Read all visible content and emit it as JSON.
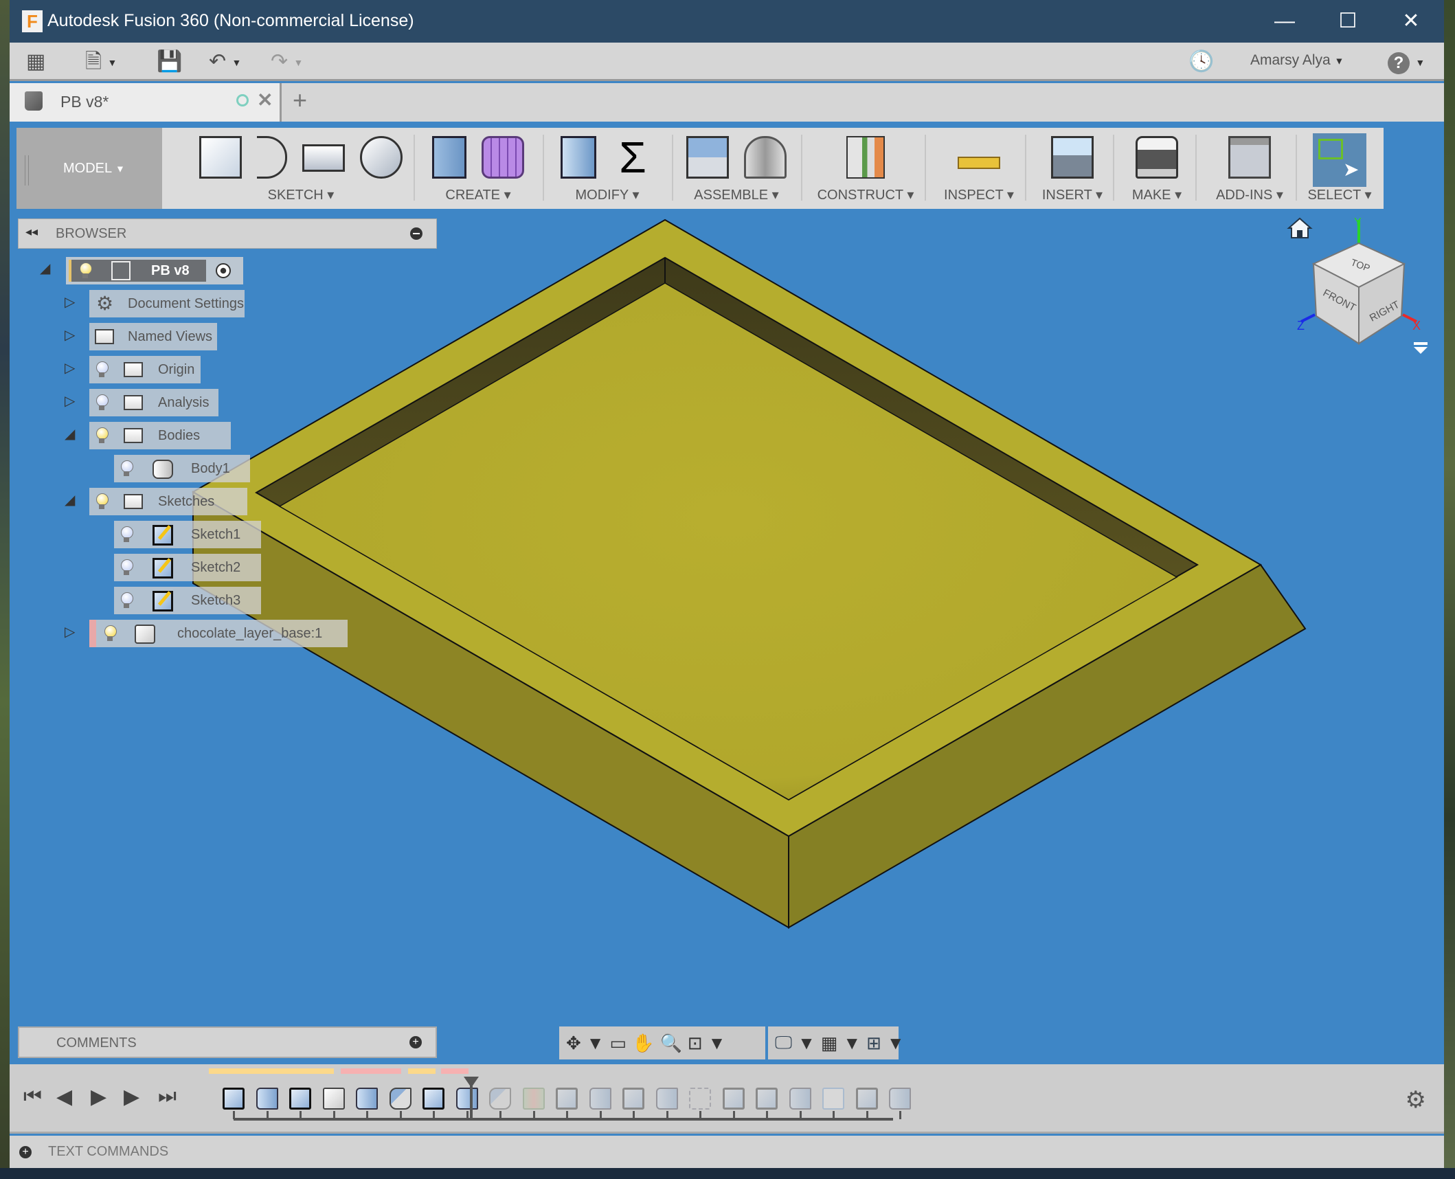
{
  "window": {
    "title": "Autodesk Fusion 360 (Non-commercial License)",
    "logo_letter": "F",
    "controls": {
      "minimize": "—",
      "maximize": "☐",
      "close": "✕"
    }
  },
  "quick_access": {
    "apps_icon": "▦",
    "file_icon": "🗎",
    "save_icon": "💾",
    "undo_icon": "↶",
    "redo_icon": "↷",
    "job_status_icon": "🕓",
    "user_name": "Amarsy Alya",
    "help_icon": "?"
  },
  "document_tab": {
    "name": "PB v8*",
    "close": "✕",
    "new_tab": "+"
  },
  "toolbar": {
    "workspace": "MODEL",
    "groups": [
      {
        "label": "SKETCH",
        "icons": [
          "create-sketch",
          "line-arc",
          "rectangle",
          "circle"
        ]
      },
      {
        "label": "CREATE",
        "icons": [
          "extrude",
          "form"
        ]
      },
      {
        "label": "MODIFY",
        "icons": [
          "press-pull",
          "parameters"
        ]
      },
      {
        "label": "ASSEMBLE",
        "icons": [
          "new-component",
          "joint"
        ]
      },
      {
        "label": "CONSTRUCT",
        "icons": [
          "offset-plane"
        ]
      },
      {
        "label": "INSPECT",
        "icons": [
          "measure"
        ]
      },
      {
        "label": "INSERT",
        "icons": [
          "insert-image"
        ]
      },
      {
        "label": "MAKE",
        "icons": [
          "3d-print"
        ]
      },
      {
        "label": "ADD-INS",
        "icons": [
          "scripts-addins"
        ]
      },
      {
        "label": "SELECT",
        "icons": [
          "window-select"
        ]
      }
    ]
  },
  "browser": {
    "title": "BROWSER",
    "root": {
      "name": "PB v8"
    },
    "nodes": [
      {
        "label": "Document Settings",
        "expanded": false
      },
      {
        "label": "Named Views",
        "expanded": false
      },
      {
        "label": "Origin",
        "expanded": false,
        "visible": false
      },
      {
        "label": "Analysis",
        "expanded": false,
        "visible": false
      },
      {
        "label": "Bodies",
        "expanded": true,
        "visible": true,
        "children": [
          {
            "label": "Body1"
          }
        ]
      },
      {
        "label": "Sketches",
        "expanded": true,
        "visible": true,
        "children": [
          {
            "label": "Sketch1"
          },
          {
            "label": "Sketch2"
          },
          {
            "label": "Sketch3"
          }
        ]
      },
      {
        "label": "chocolate_layer_base:1",
        "expanded": false,
        "visible": true
      }
    ]
  },
  "viewcube": {
    "top": "TOP",
    "front": "FRONT",
    "right": "RIGHT",
    "axis_x": "X",
    "axis_y": "Y",
    "axis_z": "Z"
  },
  "comments": {
    "title": "COMMENTS"
  },
  "navbar": {
    "icons": [
      "orbit",
      "look-at",
      "pan",
      "zoom",
      "fit",
      "display-settings",
      "grid-snaps",
      "viewports"
    ]
  },
  "timeline": {
    "active_features": [
      "sketch",
      "extrude",
      "sketch",
      "body",
      "extrude",
      "fillet",
      "sketch",
      "extrude"
    ],
    "rolled_back_features": [
      "fillet",
      "split",
      "sketch",
      "extrude",
      "sketch",
      "extrude",
      "pattern",
      "sketch",
      "sketch",
      "extrude",
      "combine",
      "sketch",
      "extrude"
    ]
  },
  "text_commands": {
    "title": "TEXT COMMANDS"
  },
  "colors": {
    "title_bar": "#2c4a66",
    "viewport": "#3e86c6",
    "model_top": "#b5ad2e",
    "model_side": "#8a8224",
    "model_inner_wall": "#4a4520"
  }
}
